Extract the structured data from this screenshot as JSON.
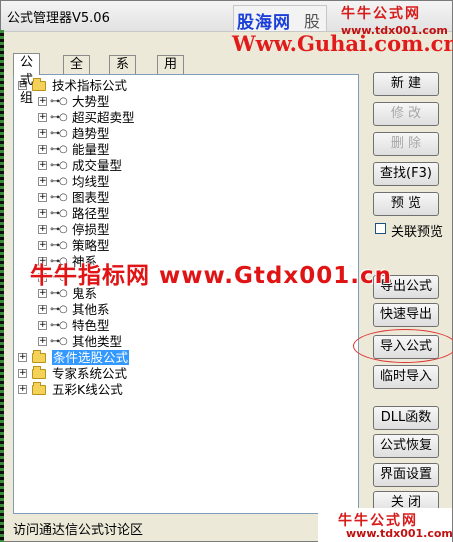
{
  "window": {
    "title": "公式管理器V5.06"
  },
  "watermarks": {
    "brand_box_1": "股海网",
    "brand_box_2": "股",
    "top_right_cn": "牛牛公式网",
    "top_right_url": "www.tdx001.com",
    "guhai_url": "Www.Guhai.com.cn",
    "middle": "牛牛指标网 www.Gtdx001.cn",
    "bottom_right_cn": "牛牛公式网",
    "bottom_right_url": "www.tdx001.com"
  },
  "tabs": [
    {
      "label": "公式组",
      "active": true
    },
    {
      "label": "全部",
      "active": false
    },
    {
      "label": "系统",
      "active": false
    },
    {
      "label": "用户",
      "active": false
    }
  ],
  "tree": {
    "root_expander": "⊟",
    "child_expander": "+",
    "nodes": [
      {
        "label": "技术指标公式",
        "type": "folder",
        "expanded": true
      },
      {
        "label": "大势型",
        "type": "key"
      },
      {
        "label": "超买超卖型",
        "type": "key"
      },
      {
        "label": "趋势型",
        "type": "key"
      },
      {
        "label": "能量型",
        "type": "key"
      },
      {
        "label": "成交量型",
        "type": "key"
      },
      {
        "label": "均线型",
        "type": "key"
      },
      {
        "label": "图表型",
        "type": "key"
      },
      {
        "label": "路径型",
        "type": "key"
      },
      {
        "label": "停损型",
        "type": "key"
      },
      {
        "label": "策略型",
        "type": "key"
      },
      {
        "label": "神系",
        "type": "key"
      },
      {
        "label": "",
        "type": "key"
      },
      {
        "label": "鬼系",
        "type": "key"
      },
      {
        "label": "其他系",
        "type": "key"
      },
      {
        "label": "特色型",
        "type": "key"
      },
      {
        "label": "其他类型",
        "type": "key"
      },
      {
        "label": "条件选股公式",
        "type": "folder",
        "selected": true
      },
      {
        "label": "专家系统公式",
        "type": "folder"
      },
      {
        "label": "五彩K线公式",
        "type": "folder"
      }
    ]
  },
  "buttons": {
    "new": "新 建",
    "modify": "修 改",
    "delete": "删 除",
    "find": "查找(F3)",
    "preview": "预 览",
    "linked_preview": "关联预览",
    "export": "导出公式",
    "quick_export": "快速导出",
    "import": "导入公式",
    "temp_import": "临时导入",
    "dll": "DLL函数",
    "restore": "公式恢复",
    "ui_settings": "界面设置",
    "close": "关 闭"
  },
  "status": {
    "text": "访问通达信公式讨论区"
  },
  "colors": {
    "selection": "#3399ff",
    "watermark_red": "#e01414",
    "brand_blue": "#1b3fd8"
  }
}
